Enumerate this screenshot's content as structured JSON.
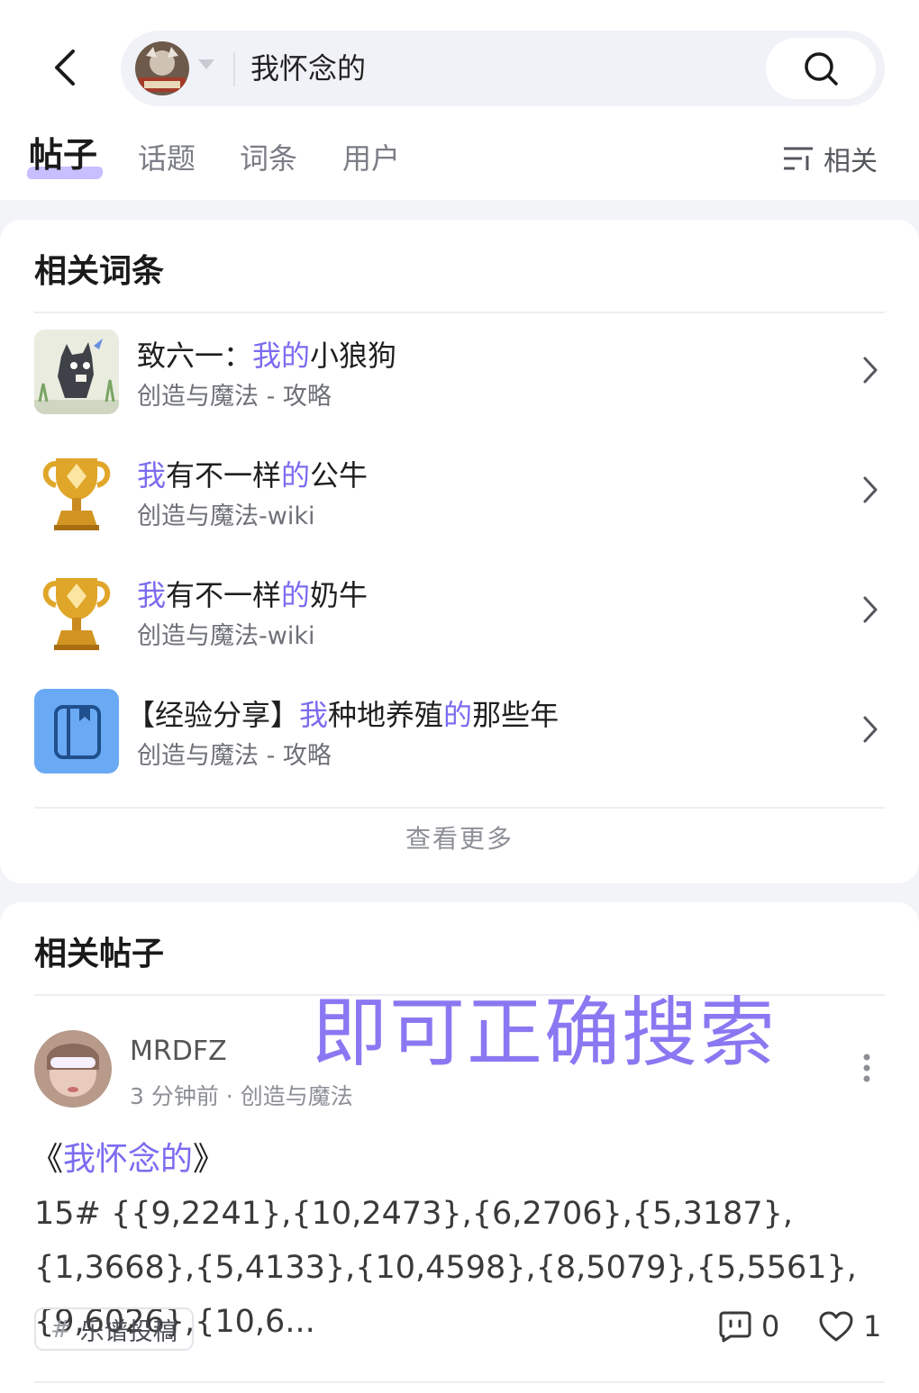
{
  "search": {
    "query": "我怀念的"
  },
  "tabs": [
    {
      "label": "帖子",
      "active": true
    },
    {
      "label": "话题"
    },
    {
      "label": "词条"
    },
    {
      "label": "用户"
    }
  ],
  "filter": {
    "label": "相关"
  },
  "related_entries": {
    "title": "相关词条",
    "items": [
      {
        "title_pre": "致六一：",
        "title_hl": "我的",
        "title_post": "小狼狗",
        "sub": "创造与魔法 - 攻略",
        "icon": "wolf-pixel-art-thumbnail"
      },
      {
        "title_hl": "我",
        "title_mid": "有不一样",
        "title_hl2": "的",
        "title_post": "公牛",
        "sub": "创造与魔法-wiki",
        "icon": "trophy-icon"
      },
      {
        "title_hl": "我",
        "title_mid": "有不一样",
        "title_hl2": "的",
        "title_post": "奶牛",
        "sub": "创造与魔法-wiki",
        "icon": "trophy-icon"
      },
      {
        "title_pre": "【经验分享】",
        "title_hl": "我",
        "title_mid": "种地养殖",
        "title_hl2": "的",
        "title_post": "那些年",
        "sub": "创造与魔法 - 攻略",
        "icon": "book-icon"
      }
    ],
    "more": "查看更多"
  },
  "related_posts": {
    "title": "相关帖子",
    "overlay_text": "即可正确搜索",
    "post": {
      "author": "MRDFZ",
      "meta": "3 分钟前 · 创造与魔法",
      "title_pre": "《",
      "title_hl": "我怀念的",
      "title_post": "》",
      "body": "15# {{9,2241},{10,2473},{6,2706},{5,3187},{1,3668},{5,4133},{10,4598},{8,5079},{5,5561},{9,6026},{10,6...",
      "tag": "乐谱投稿",
      "tag_hash": "#",
      "comments": "0",
      "likes": "1"
    }
  },
  "colors": {
    "accent": "#7a6cf0",
    "underline": "#bdb4ff",
    "background": "#f3f4f8"
  }
}
